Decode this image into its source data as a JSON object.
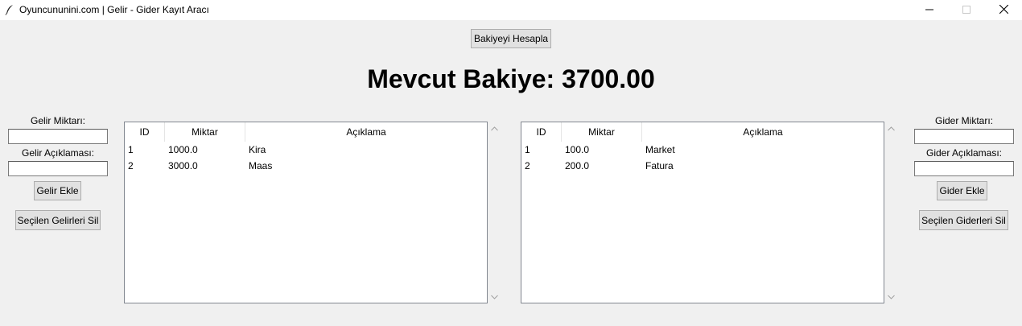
{
  "window": {
    "title": "Oyuncununini.com | Gelir - Gider Kayıt Aracı"
  },
  "toolbar": {
    "calculate_label": "Bakiyeyi Hesapla"
  },
  "balance": {
    "text": "Mevcut Bakiye: 3700.00"
  },
  "income": {
    "amount_label": "Gelir Miktarı:",
    "amount_value": "",
    "description_label": "Gelir Açıklaması:",
    "description_value": "",
    "add_label": "Gelir Ekle",
    "delete_label": "Seçilen Gelirleri Sil",
    "columns": [
      "ID",
      "Miktar",
      "Açıklama"
    ],
    "rows": [
      {
        "id": "1",
        "amount": "1000.0",
        "description": "Kira"
      },
      {
        "id": "2",
        "amount": "3000.0",
        "description": "Maas"
      }
    ]
  },
  "expense": {
    "amount_label": "Gider Miktarı:",
    "amount_value": "",
    "description_label": "Gider Açıklaması:",
    "description_value": "",
    "add_label": "Gider Ekle",
    "delete_label": "Seçilen Giderleri Sil",
    "columns": [
      "ID",
      "Miktar",
      "Açıklama"
    ],
    "rows": [
      {
        "id": "1",
        "amount": "100.0",
        "description": "Market"
      },
      {
        "id": "2",
        "amount": "200.0",
        "description": "Fatura"
      }
    ]
  },
  "icons": {
    "app": "feather-icon",
    "minimize": "minimize-icon",
    "maximize": "maximize-icon",
    "close": "close-icon",
    "scroll_up": "chevron-up-icon",
    "scroll_down": "chevron-down-icon"
  }
}
